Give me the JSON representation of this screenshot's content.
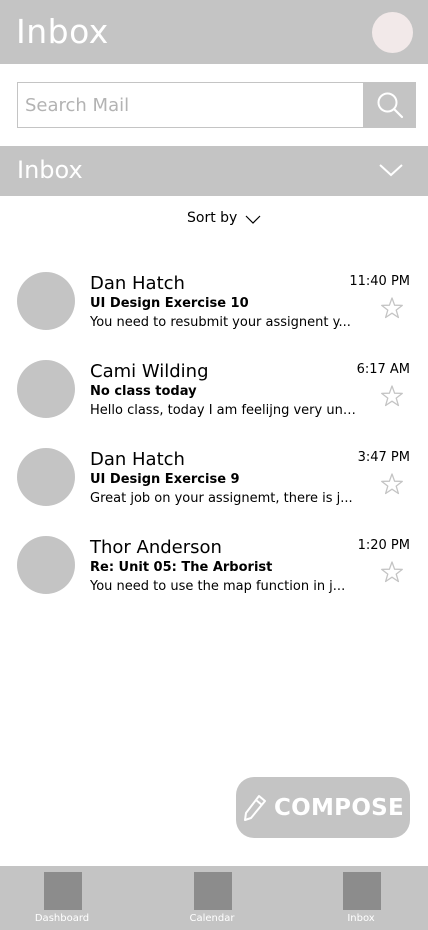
{
  "header": {
    "title": "Inbox",
    "avatar_icon": "user-avatar",
    "avatar_color": "#f2e9e9"
  },
  "search": {
    "placeholder": "Search Mail",
    "value": "",
    "button_icon": "search-icon"
  },
  "folder_bar": {
    "label": "Inbox",
    "icon": "chevron-down-icon"
  },
  "sort": {
    "label": "Sort by",
    "icon": "chevron-down-icon"
  },
  "mails": [
    {
      "sender": "Dan Hatch",
      "subject": "UI Design Exercise 10",
      "preview": "You need to resubmit your assignent y...",
      "time": "11:40 PM",
      "starred": false
    },
    {
      "sender": "Cami Wilding",
      "subject": "No class today",
      "preview": "Hello class, today I am feelijng very und...",
      "time": "6:17 AM",
      "starred": false
    },
    {
      "sender": "Dan Hatch",
      "subject": "UI Design Exercise 9",
      "preview": "Great job on your assignemt, there is j...",
      "time": "3:47 PM",
      "starred": false
    },
    {
      "sender": "Thor Anderson",
      "subject": "Re: Unit 05: The Arborist",
      "preview": "You need to use the map function in j...",
      "time": "1:20 PM",
      "starred": false
    }
  ],
  "compose": {
    "label": "COMPOSE",
    "icon": "pencil-icon"
  },
  "bottom_nav": {
    "items": [
      {
        "label": "Dashboard",
        "icon": "dashboard-icon"
      },
      {
        "label": "Calendar",
        "icon": "calendar-icon"
      },
      {
        "label": "Inbox",
        "icon": "inbox-icon"
      }
    ]
  },
  "colors": {
    "bar_gray": "#c4c4c4",
    "nav_icon_gray": "#8c8c8c",
    "text_white": "#ffffff"
  }
}
